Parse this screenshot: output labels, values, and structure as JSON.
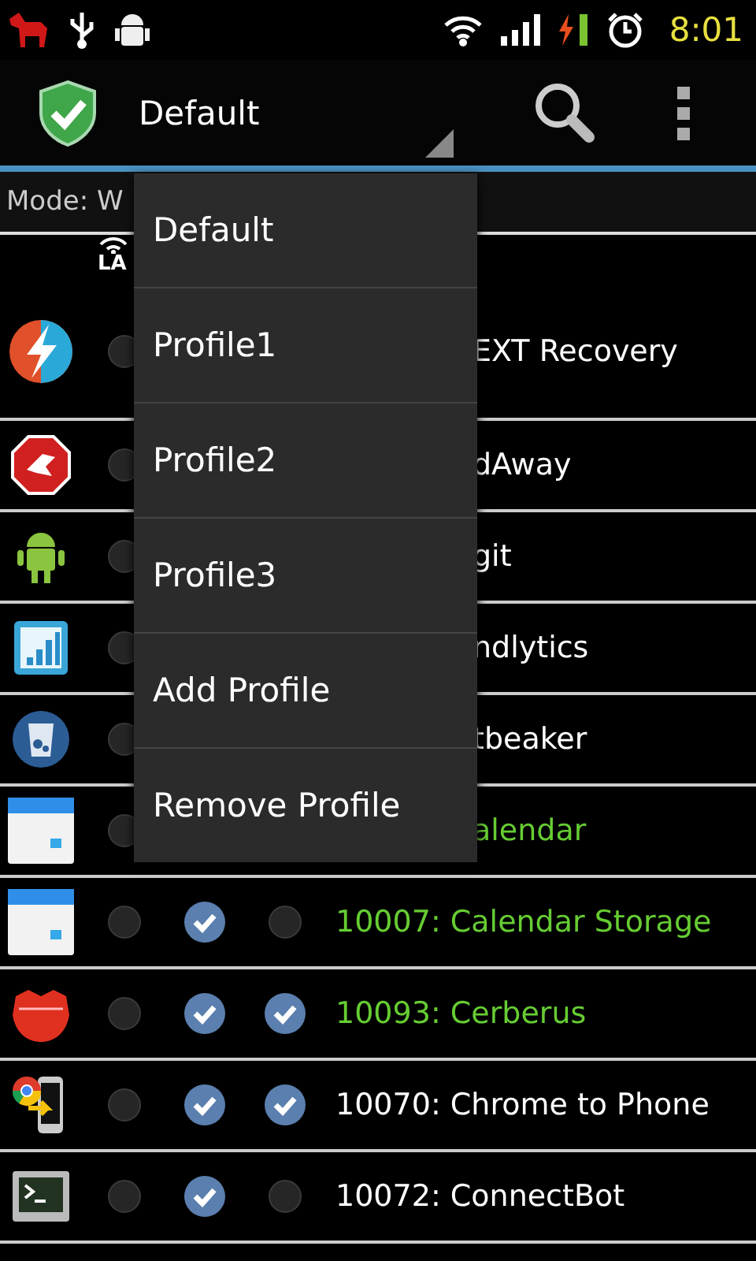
{
  "status_bar": {
    "time": "8:01"
  },
  "action_bar": {
    "profile": "Default"
  },
  "mode": "Mode: W",
  "header": {
    "column_1": "LA"
  },
  "rows": [
    {
      "name": "EXT Recovery",
      "color": "#ffffff",
      "checks": [
        false
      ]
    },
    {
      "name": "dAway",
      "color": "#ffffff",
      "checks": [
        false
      ]
    },
    {
      "name": "git",
      "color": "#ffffff",
      "checks": [
        false
      ]
    },
    {
      "name": "ndlytics",
      "color": "#ffffff",
      "checks": [
        false
      ]
    },
    {
      "name": "tbeaker",
      "color": "#ffffff",
      "checks": [
        false
      ]
    },
    {
      "name": "alendar",
      "color": "#66cc33",
      "checks": [
        false
      ]
    },
    {
      "name": "10007: Calendar Storage",
      "color": "#66cc33",
      "checks": [
        false,
        true,
        false
      ]
    },
    {
      "name": "10093: Cerberus",
      "color": "#66cc33",
      "checks": [
        false,
        true,
        true
      ]
    },
    {
      "name": "10070: Chrome to Phone",
      "color": "#ffffff",
      "checks": [
        false,
        true,
        true
      ]
    },
    {
      "name": "10072: ConnectBot",
      "color": "#ffffff",
      "checks": [
        false,
        true,
        false
      ]
    }
  ],
  "menu": {
    "items": [
      "Default",
      "Profile1",
      "Profile2",
      "Profile3",
      "Add Profile",
      "Remove Profile"
    ]
  }
}
